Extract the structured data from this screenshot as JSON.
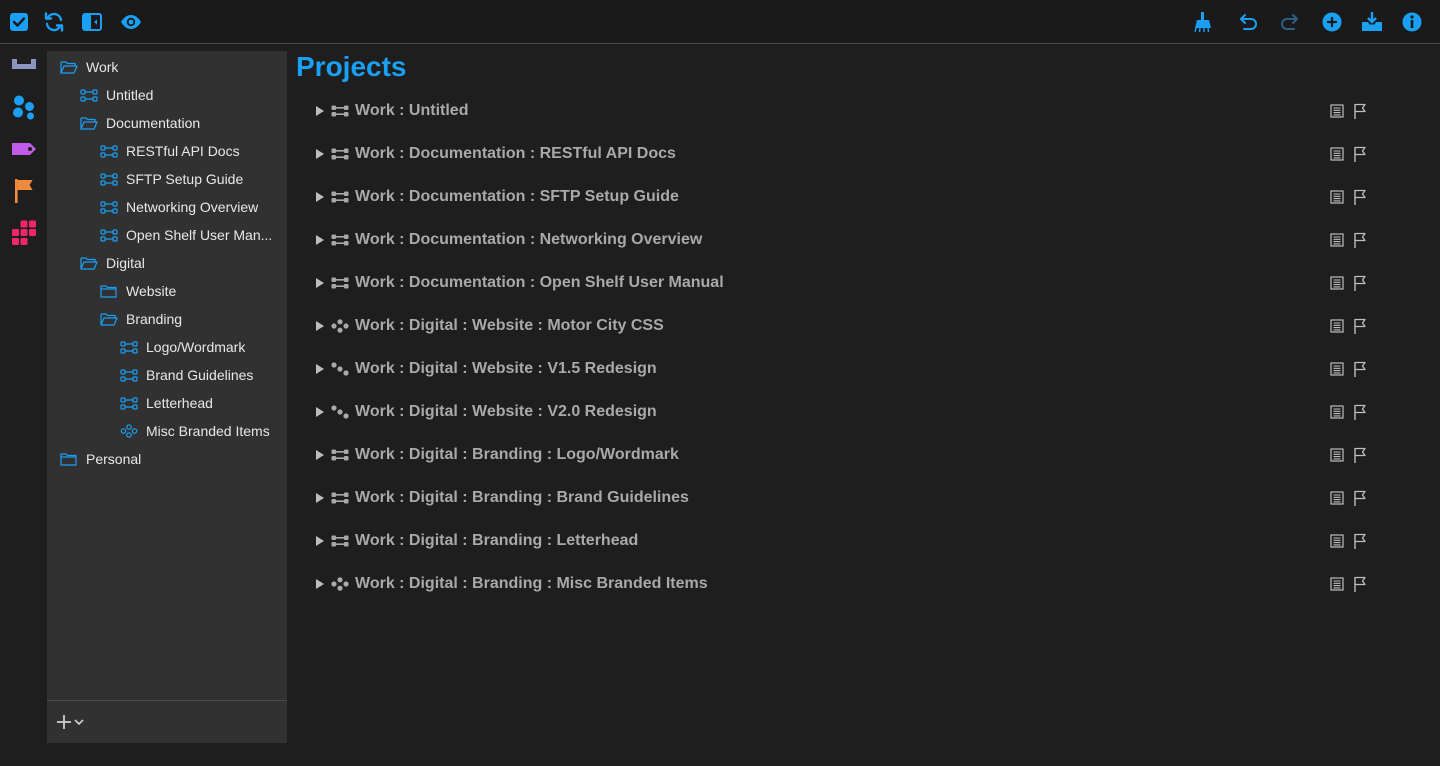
{
  "colors": {
    "accent": "#19a0f5",
    "purple": "#c05be8",
    "orange": "#f08a3c",
    "pink": "#f0266b",
    "tray": "#8e94c0"
  },
  "toolbar": {
    "left_icons": [
      "checkbox-icon",
      "sync-icon",
      "sidebar-toggle-icon",
      "eye-icon"
    ],
    "right_icons": [
      "clean-up-icon",
      "undo-icon",
      "redo-icon",
      "add-icon",
      "inbox-icon",
      "info-icon"
    ]
  },
  "rail": {
    "icons": [
      "inbox-tray-icon",
      "projects-icon",
      "tags-icon",
      "flag-icon",
      "perspectives-grid-icon"
    ]
  },
  "sidebar": {
    "items": [
      {
        "label": "Work",
        "icon": "folder-open-icon",
        "level": 0
      },
      {
        "label": "Untitled",
        "icon": "project-icon",
        "level": 1
      },
      {
        "label": "Documentation",
        "icon": "folder-open-icon",
        "level": 1
      },
      {
        "label": "RESTful API Docs",
        "icon": "project-icon",
        "level": 2
      },
      {
        "label": "SFTP Setup Guide",
        "icon": "project-icon",
        "level": 2
      },
      {
        "label": "Networking Overview",
        "icon": "project-icon",
        "level": 2
      },
      {
        "label": "Open Shelf User Man...",
        "icon": "project-icon",
        "level": 2
      },
      {
        "label": "Digital",
        "icon": "folder-open-icon",
        "level": 1
      },
      {
        "label": "Website",
        "icon": "folder-closed-icon",
        "level": 2
      },
      {
        "label": "Branding",
        "icon": "folder-open-icon",
        "level": 2
      },
      {
        "label": "Logo/Wordmark",
        "icon": "project-icon",
        "level": 3
      },
      {
        "label": "Brand Guidelines",
        "icon": "project-icon",
        "level": 3
      },
      {
        "label": "Letterhead",
        "icon": "project-icon",
        "level": 3
      },
      {
        "label": "Misc Branded Items",
        "icon": "single-actions-icon",
        "level": 3
      },
      {
        "label": "Personal",
        "icon": "folder-closed-icon",
        "level": 0
      }
    ],
    "footer": {
      "add_icon": "plus-icon",
      "menu_icon": "chevron-down-icon"
    }
  },
  "main": {
    "title": "Projects",
    "projects": [
      {
        "title": "Work : Untitled",
        "type": "sequential-icon"
      },
      {
        "title": "Work : Documentation : RESTful API Docs",
        "type": "sequential-icon"
      },
      {
        "title": "Work : Documentation : SFTP Setup Guide",
        "type": "sequential-icon"
      },
      {
        "title": "Work : Documentation : Networking Overview",
        "type": "sequential-icon"
      },
      {
        "title": "Work : Documentation : Open Shelf User Manual",
        "type": "sequential-icon"
      },
      {
        "title": "Work : Digital : Website : Motor City CSS",
        "type": "single-actions-icon"
      },
      {
        "title": "Work : Digital : Website : V1.5 Redesign",
        "type": "parallel-icon"
      },
      {
        "title": "Work : Digital : Website : V2.0 Redesign",
        "type": "parallel-icon"
      },
      {
        "title": "Work : Digital : Branding : Logo/Wordmark",
        "type": "sequential-icon"
      },
      {
        "title": "Work : Digital : Branding : Brand Guidelines",
        "type": "sequential-icon"
      },
      {
        "title": "Work : Digital : Branding : Letterhead",
        "type": "sequential-icon"
      },
      {
        "title": "Work : Digital : Branding : Misc Branded Items",
        "type": "single-actions-icon"
      }
    ]
  }
}
